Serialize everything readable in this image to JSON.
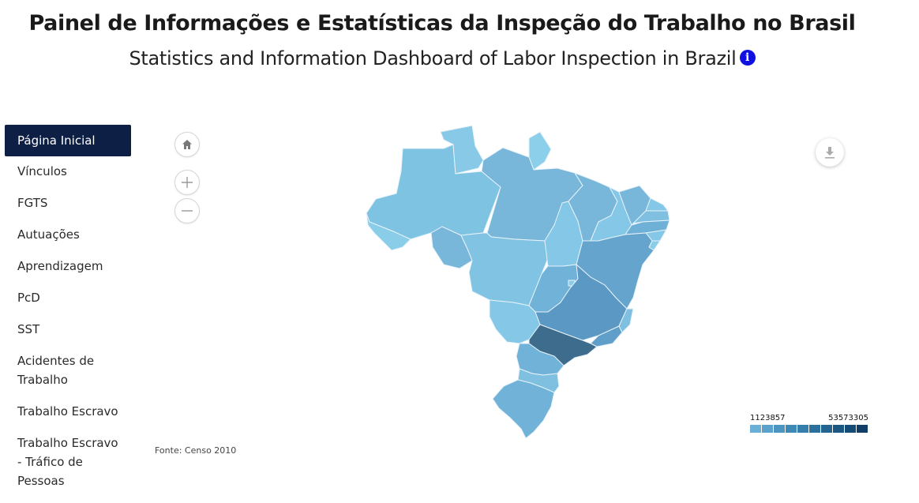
{
  "header": {
    "title_pt": "Painel de Informações e Estatísticas da Inspeção do Trabalho no Brasil",
    "title_en": "Statistics and Information Dashboard of Labor Inspection in Brazil",
    "info_icon": "info-icon"
  },
  "sidebar": {
    "items": [
      {
        "label": "Página Inicial"
      },
      {
        "label": "Vínculos"
      },
      {
        "label": "FGTS"
      },
      {
        "label": "Autuações"
      },
      {
        "label": "Aprendizagem"
      },
      {
        "label": "PcD"
      },
      {
        "label": "SST"
      },
      {
        "label": "Acidentes de Trabalho"
      },
      {
        "label": "Trabalho Escravo"
      },
      {
        "label": "Trabalho Escravo - Tráfico de Pessoas"
      }
    ]
  },
  "map_controls": {
    "home_icon": "home-icon",
    "zoom_in_icon": "plus-icon",
    "zoom_out_icon": "minus-icon",
    "download_icon": "download-icon"
  },
  "source": "Fonte: Censo 2010",
  "legend": {
    "min": "1123857",
    "max": "53573305",
    "colors": [
      "#6aafd6",
      "#5aa2cc",
      "#4b95c2",
      "#3f89b7",
      "#357daa",
      "#2c709e",
      "#246491",
      "#1c5784",
      "#154b77",
      "#0f3f69"
    ]
  },
  "colors": {
    "accent": "#0e1f45",
    "info": "#1010e0"
  }
}
